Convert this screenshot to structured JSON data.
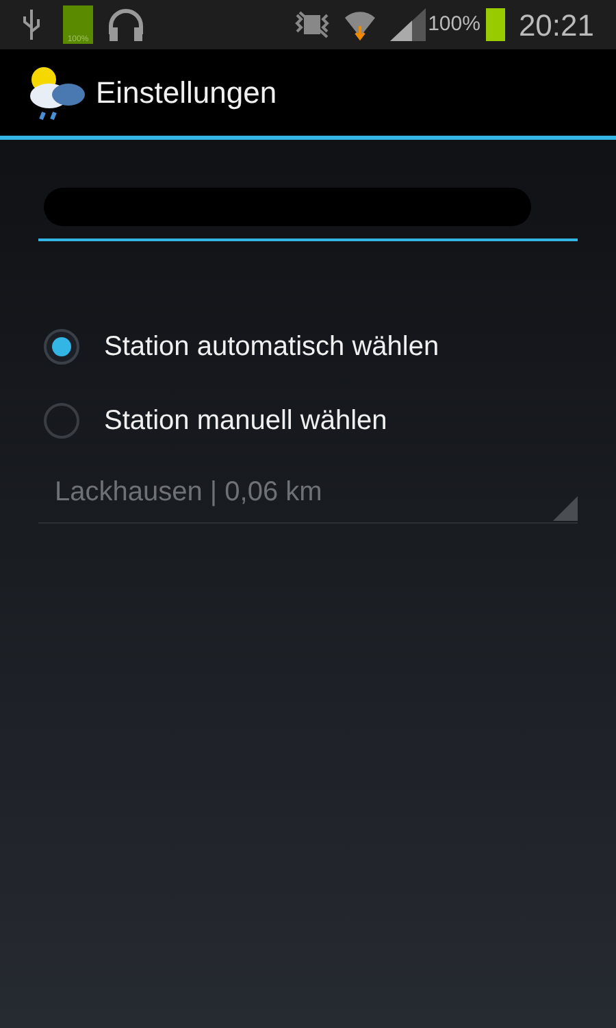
{
  "status_bar": {
    "left_battery_label": "100%",
    "battery_percent": "100%",
    "time": "20:21"
  },
  "action_bar": {
    "title": "Einstellungen"
  },
  "name_field": {
    "focused": true
  },
  "station_mode": [
    {
      "label": "Station automatisch wählen",
      "selected": true
    },
    {
      "label": "Station manuell wählen",
      "selected": false
    }
  ],
  "station_spinner": {
    "value": "Lackhausen | 0,06 km",
    "disabled": true
  }
}
